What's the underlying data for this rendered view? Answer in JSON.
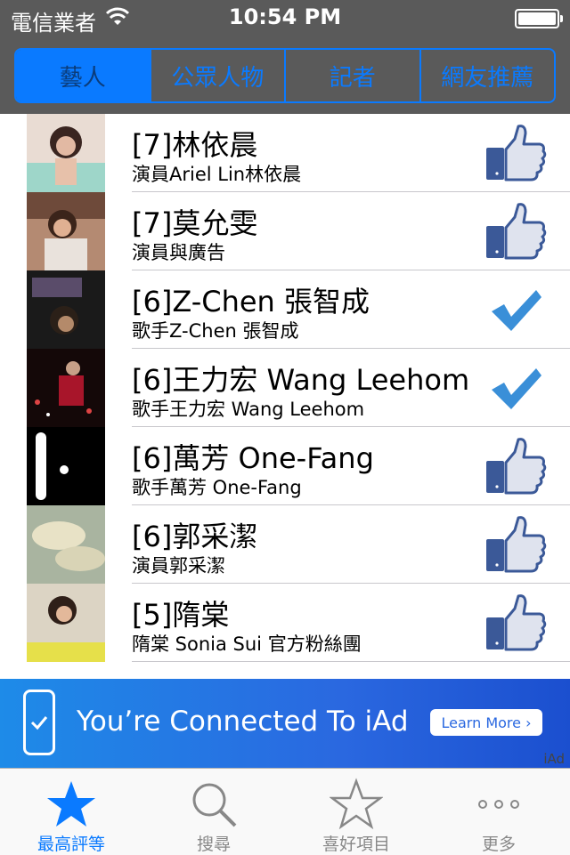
{
  "status_bar": {
    "carrier": "電信業者",
    "time": "10:54 PM"
  },
  "segments": [
    {
      "label": "藝人",
      "active": true
    },
    {
      "label": "公眾人物",
      "active": false
    },
    {
      "label": "記者",
      "active": false
    },
    {
      "label": "網友推薦",
      "active": false
    }
  ],
  "list": [
    {
      "title": "[7]林依晨",
      "subtitle": "演員Ariel Lin林依晨",
      "status": "thumbs-up-icon"
    },
    {
      "title": "[7]莫允雯",
      "subtitle": "演員與廣告",
      "status": "thumbs-up-icon"
    },
    {
      "title": "[6]Z-Chen 張智成",
      "subtitle": "歌手Z-Chen 張智成",
      "status": "checkmark-icon"
    },
    {
      "title": "[6]王力宏 Wang Leehom",
      "subtitle": "歌手王力宏 Wang Leehom",
      "status": "checkmark-icon"
    },
    {
      "title": "[6]萬芳 One-Fang",
      "subtitle": "歌手萬芳 One-Fang",
      "status": "thumbs-up-icon"
    },
    {
      "title": "[6]郭采潔",
      "subtitle": "演員郭采潔",
      "status": "thumbs-up-icon"
    },
    {
      "title": "[5]隋棠",
      "subtitle": "隋棠 Sonia Sui 官方粉絲團",
      "status": "thumbs-up-icon"
    }
  ],
  "ad": {
    "text": "You’re Connected To iAd",
    "button": "Learn More ›",
    "logo": "iAd"
  },
  "tabs": [
    {
      "label": "最高評等",
      "icon": "star-filled-icon",
      "active": true
    },
    {
      "label": "搜尋",
      "icon": "search-icon",
      "active": false
    },
    {
      "label": "喜好項目",
      "icon": "star-outline-icon",
      "active": false
    },
    {
      "label": "更多",
      "icon": "more-icon",
      "active": false
    }
  ],
  "colors": {
    "accent": "#0a7aff",
    "header": "#5a5a5a",
    "facebook_blue": "#3b5998"
  }
}
